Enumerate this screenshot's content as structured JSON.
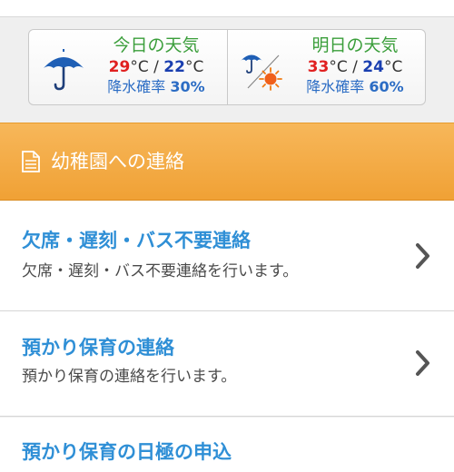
{
  "weather": {
    "today": {
      "label": "今日の天気",
      "icon": "umbrella-icon",
      "high": "29",
      "low": "22",
      "unit": "°C",
      "separator": " / ",
      "rain_label": "降水確率",
      "rain_pct": "30%"
    },
    "tomorrow": {
      "label": "明日の天気",
      "icon": "umbrella-sun-icon",
      "high": "33",
      "low": "24",
      "unit": "°C",
      "separator": " / ",
      "rain_label": "降水確率",
      "rain_pct": "60%"
    }
  },
  "section": {
    "icon": "document-icon",
    "title": "幼稚園への連絡"
  },
  "items": [
    {
      "title": "欠席・遅刻・バス不要連絡",
      "desc": "欠席・遅刻・バス不要連絡を行います。"
    },
    {
      "title": "預かり保育の連絡",
      "desc": "預かり保育の連絡を行います。"
    },
    {
      "title": "預かり保育の日極の申込",
      "desc": ""
    }
  ],
  "colors": {
    "accent_orange": "#f0a135",
    "link_blue": "#2f8fd6",
    "label_green": "#3a9e3a",
    "high_red": "#e02020",
    "low_blue": "#1a3fb0"
  }
}
